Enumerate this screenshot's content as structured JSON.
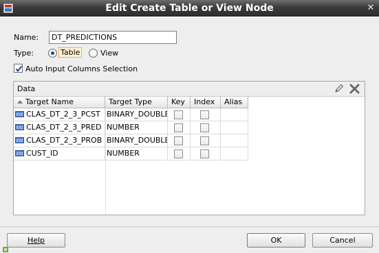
{
  "window": {
    "title": "Edit Create Table or View Node",
    "close_glyph": "✕",
    "icon": "oracle-app-icon"
  },
  "form": {
    "name_label": "Name:",
    "name_value": "DT_PREDICTIONS",
    "type_label": "Type:",
    "type_options": [
      {
        "label": "Table",
        "selected": true
      },
      {
        "label": "View",
        "selected": false
      }
    ],
    "auto_input_label": "Auto Input Columns Selection",
    "auto_input_checked": true
  },
  "data_panel": {
    "title": "Data",
    "edit_icon": "pencil-icon",
    "delete_icon": "delete-x-icon",
    "columns": [
      "Target Name",
      "Target Type",
      "Key",
      "Index",
      "Alias"
    ],
    "rows": [
      {
        "name": "CLAS_DT_2_3_PCST",
        "type": "BINARY_DOUBLE",
        "key": false,
        "index": false,
        "alias": ""
      },
      {
        "name": "CLAS_DT_2_3_PRED",
        "type": "NUMBER",
        "key": false,
        "index": false,
        "alias": ""
      },
      {
        "name": "CLAS_DT_2_3_PROB",
        "type": "BINARY_DOUBLE",
        "key": false,
        "index": false,
        "alias": ""
      },
      {
        "name": "CUST_ID",
        "type": "NUMBER",
        "key": false,
        "index": false,
        "alias": ""
      }
    ]
  },
  "buttons": {
    "help": "Help",
    "ok": "OK",
    "cancel": "Cancel"
  },
  "colors": {
    "titlebar": "#3c3c3c",
    "accent_check": "#1c4f8c",
    "column_icon": "#2a4f9c"
  }
}
